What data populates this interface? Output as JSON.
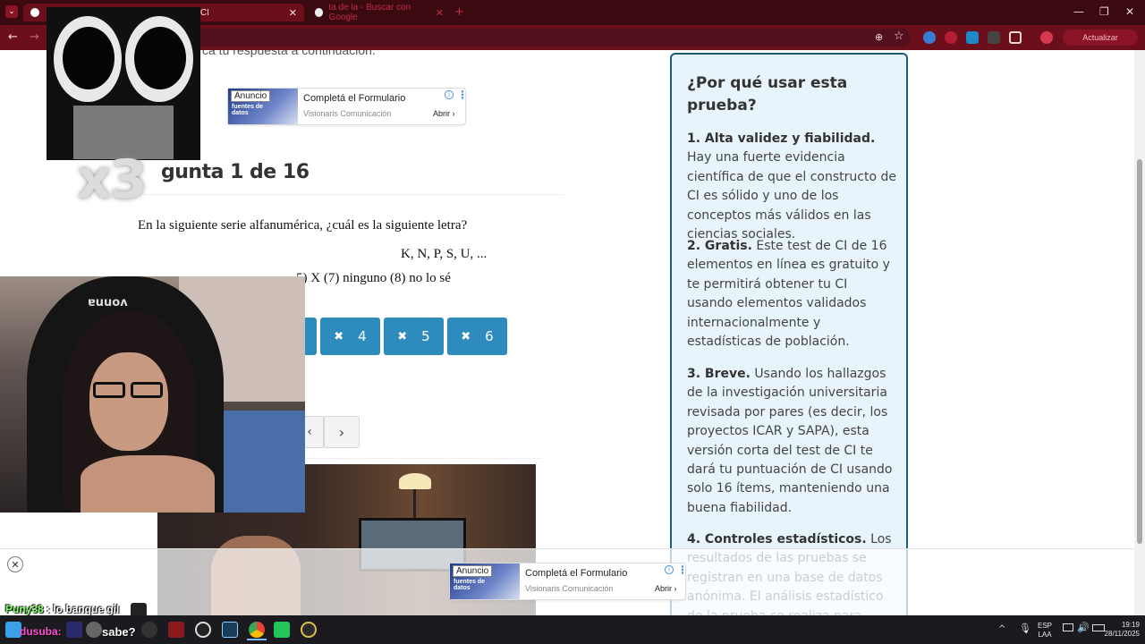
{
  "browser": {
    "tabs": [
      {
        "title": "de CI",
        "active": true
      },
      {
        "title": "ta de la - Buscar con Google",
        "active": false
      }
    ],
    "new_tab": "+",
    "close": "✕",
    "back": "←",
    "forward": "→",
    "profile_label": "Actualizar",
    "window_controls": [
      "—",
      "❐",
      "✕"
    ]
  },
  "page": {
    "instruction_fragment": "ca tu respuesta a continuación.",
    "top_ad": {
      "tag": "Anuncio",
      "image_text": "fuentes de datos",
      "title": "Completá el Formulario",
      "advertiser": "Visionaris Comunicación",
      "cta": "Abrir"
    },
    "question": {
      "title": "gunta 1 de 16",
      "text": "En la siguiente serie alfanumérica, ¿cuál es la siguiente letra?",
      "series": "K, N, P, S, U, ...",
      "options_fragment": "5) X (7) ninguno (8) no lo sé"
    },
    "answer_buttons": [
      "4",
      "5",
      "6"
    ],
    "nav": {
      "prev": "‹",
      "next": "›"
    },
    "sidebar": {
      "title": "¿Por qué usar esta prueba?",
      "points": [
        {
          "bold": "1. Alta validez y fiabilidad.",
          "text": " Hay una fuerte evidencia científica de que el constructo de CI es sólido y uno de los conceptos más válidos en las ciencias sociales."
        },
        {
          "bold": "2. Gratis.",
          "text": " Este test de CI de 16 elementos en línea es gratuito y te permitirá obtener tu CI usando elementos validados internacionalmente y estadísticas de población."
        },
        {
          "bold": "3. Breve.",
          "text": " Usando los hallazgos de la investigación universitaria revisada por pares (es decir, los proyectos ICAR y SAPA), esta versión corta del test de CI te dará tu puntuación de CI usando solo 16 ítems, manteniendo una buena fiabilidad."
        },
        {
          "bold": "4. Controles estadísticos.",
          "text": " Los resultados de las pruebas se registran en una base de datos anónima. El análisis estadístico de la prueba se realiza para asegurar"
        }
      ]
    },
    "bottom_ad": {
      "tag": "Anuncio",
      "image_text": "fuentes de datos",
      "title": "Completá el Formulario",
      "advertiser": "Visionaris Comunicación",
      "cta": "Abrir",
      "close": "✕"
    }
  },
  "overlay": {
    "sticker_text": "x3",
    "chat_line_1": {
      "user": "Puny38",
      "message": " : lo banque gil"
    },
    "chat_line_2": {
      "user": "dusuba:",
      "message": "sabe?"
    },
    "cam_chair_text": "ɐuuoʌ"
  },
  "taskbar": {
    "lang_top": "ESP",
    "lang_bottom": "LAA",
    "time": "19:19",
    "date": "28/11/2025",
    "chevron": "^"
  },
  "colors": {
    "chrome_dark": "#3b0a11",
    "chrome_toolbar": "#6b0f1c",
    "answer_button": "#2d8bbd",
    "sidebar_bg": "#e8f4fb",
    "sidebar_border": "#1f5d7d"
  }
}
